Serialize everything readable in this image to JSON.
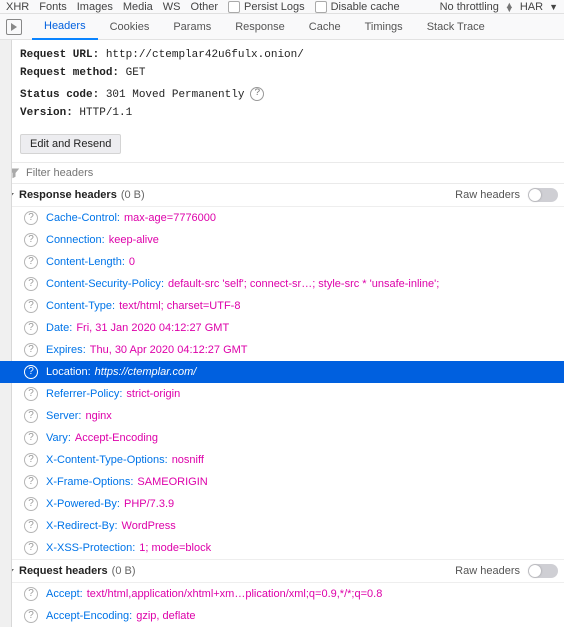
{
  "filterTypes": [
    "XHR",
    "Fonts",
    "Images",
    "Media",
    "WS",
    "Other"
  ],
  "persistLabel": "Persist Logs",
  "disableCacheLabel": "Disable cache",
  "throttling": "No throttling",
  "har": "HAR",
  "tabs": [
    "Headers",
    "Cookies",
    "Params",
    "Response",
    "Cache",
    "Timings",
    "Stack Trace"
  ],
  "activeTab": 0,
  "summary": {
    "urlLabel": "Request URL:",
    "url": "http://ctemplar42u6fulx.onion/",
    "methodLabel": "Request method:",
    "method": "GET",
    "statusLabel": "Status code:",
    "status": "301 Moved Permanently",
    "versionLabel": "Version:",
    "version": "HTTP/1.1"
  },
  "editResend": "Edit and Resend",
  "filterPlaceholder": "Filter headers",
  "respTitle": "Response headers",
  "respCount": "(0 B)",
  "rawLabel": "Raw headers",
  "respHeaders": [
    {
      "name": "Cache-Control",
      "value": "max-age=7776000",
      "sel": false
    },
    {
      "name": "Connection",
      "value": "keep-alive",
      "sel": false
    },
    {
      "name": "Content-Length",
      "value": "0",
      "sel": false
    },
    {
      "name": "Content-Security-Policy",
      "value": "default-src 'self'; connect-sr…; style-src * 'unsafe-inline';",
      "sel": false
    },
    {
      "name": "Content-Type",
      "value": "text/html; charset=UTF-8",
      "sel": false
    },
    {
      "name": "Date",
      "value": "Fri, 31 Jan 2020 04:12:27 GMT",
      "sel": false
    },
    {
      "name": "Expires",
      "value": "Thu, 30 Apr 2020 04:12:27 GMT",
      "sel": false
    },
    {
      "name": "Location",
      "value": "https://ctemplar.com/",
      "sel": true
    },
    {
      "name": "Referrer-Policy",
      "value": "strict-origin",
      "sel": false
    },
    {
      "name": "Server",
      "value": "nginx",
      "sel": false
    },
    {
      "name": "Vary",
      "value": "Accept-Encoding",
      "sel": false
    },
    {
      "name": "X-Content-Type-Options",
      "value": "nosniff",
      "sel": false
    },
    {
      "name": "X-Frame-Options",
      "value": "SAMEORIGIN",
      "sel": false
    },
    {
      "name": "X-Powered-By",
      "value": "PHP/7.3.9",
      "sel": false
    },
    {
      "name": "X-Redirect-By",
      "value": "WordPress",
      "sel": false
    },
    {
      "name": "X-XSS-Protection",
      "value": "1; mode=block",
      "sel": false
    }
  ],
  "reqTitle": "Request headers",
  "reqCount": "(0 B)",
  "reqHeaders": [
    {
      "name": "Accept",
      "value": "text/html,application/xhtml+xm…plication/xml;q=0.9,*/*;q=0.8",
      "sel": false
    },
    {
      "name": "Accept-Encoding",
      "value": "gzip, deflate",
      "sel": false
    }
  ]
}
